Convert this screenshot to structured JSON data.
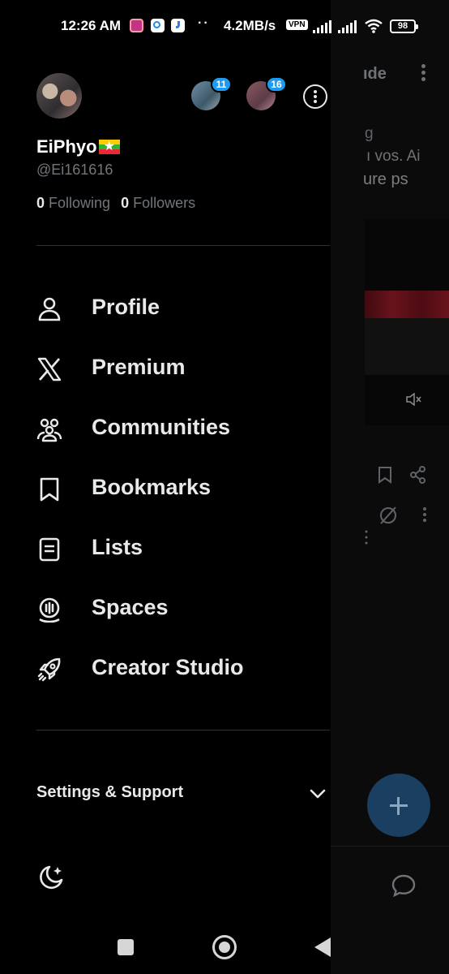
{
  "status_bar": {
    "time": "12:26 AM",
    "notification_icons": [
      "instagram-icon",
      "q-app-icon",
      "j-app-icon"
    ],
    "dots": "··",
    "speed": "4.2MB/s",
    "vpn_label": "VPN",
    "battery": "98"
  },
  "drawer": {
    "display_name": "EiPhyo",
    "handle": "@Ei161616",
    "following_count": "0",
    "following_label": "Following",
    "followers_count": "0",
    "followers_label": "Followers",
    "accounts": [
      {
        "badge": "11"
      },
      {
        "badge": "16"
      }
    ],
    "menu": [
      {
        "label": "Profile",
        "icon": "person-icon"
      },
      {
        "label": "Premium",
        "icon": "x-logo-icon"
      },
      {
        "label": "Communities",
        "icon": "communities-icon"
      },
      {
        "label": "Bookmarks",
        "icon": "bookmark-icon"
      },
      {
        "label": "Lists",
        "icon": "list-icon"
      },
      {
        "label": "Spaces",
        "icon": "spaces-icon"
      },
      {
        "label": "Creator Studio",
        "icon": "rocket-icon"
      }
    ],
    "settings_label": "Settings & Support"
  },
  "background": {
    "title_fragment": "ıde",
    "tab_fragment": "g",
    "line1_fragment": "ı vos. Ai",
    "line2_fragment": "ure ps"
  },
  "colors": {
    "background": "#000000",
    "text_primary": "#e7e9ea",
    "text_secondary": "#71767b",
    "divider": "#2f3336",
    "badge": "#1d9bf0",
    "fab": "#1a3f60"
  }
}
